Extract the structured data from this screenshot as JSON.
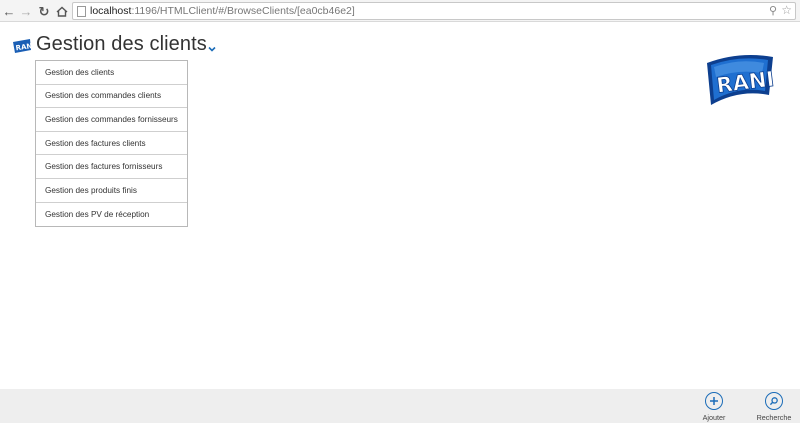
{
  "browser": {
    "url_host": "localhost",
    "url_path": ":1196/HTMLClient/#/BrowseClients/[ea0cb46e2]"
  },
  "header": {
    "title": "Gestion des clients",
    "logo_text": "RANI"
  },
  "menu": {
    "items": [
      "Gestion des clients",
      "Gestion des commandes clients",
      "Gestion des commandes fornisseurs",
      "Gestion des factures clients",
      "Gestion des factures fornisseurs",
      "Gestion des produits finis",
      "Gestion des PV de réception"
    ]
  },
  "brand": {
    "logo_text": "RANI"
  },
  "footer": {
    "add_label": "Ajouter",
    "search_label": "Recherche"
  },
  "colors": {
    "accent": "#1b6cb8",
    "footer_bg": "#eeeeee"
  }
}
